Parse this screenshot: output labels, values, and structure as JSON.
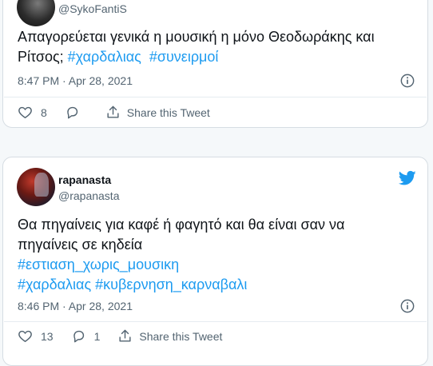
{
  "tweets": [
    {
      "handle": "@SykoFantiS",
      "text": "Απαγορεύεται γενικά η μουσική η μόνο Θεοδωράκης και Ρίτσος;",
      "hashtags": [
        "#χαρδαλιας",
        "#συνειρμοί"
      ],
      "timestamp": "8:47 PM · Apr 28, 2021",
      "likes": "8",
      "replies": "",
      "share_label": "Share this Tweet",
      "avatar_icon": "avatar-dark"
    },
    {
      "name": "rapanasta",
      "handle": "@rapanasta",
      "text_line1": "Θα πηγαίνεις για καφέ ή φαγητό και θα είναι σαν να",
      "text_line2": "πηγαίνεις σε κηδεία",
      "hashtags": [
        "#εστιαση_χωρις_μουσικη",
        "#χαρδαλιας",
        "#κυβερνηση_καρναβαλι"
      ],
      "timestamp": "8:46 PM · Apr 28, 2021",
      "likes": "13",
      "replies": "1",
      "share_label": "Share this Tweet",
      "avatar_icon": "avatar-red"
    }
  ],
  "colors": {
    "hashtag": "#1d9bf0",
    "muted": "#536471",
    "background": "#f5f8fa",
    "twitter_blue": "#1d9bf0"
  }
}
